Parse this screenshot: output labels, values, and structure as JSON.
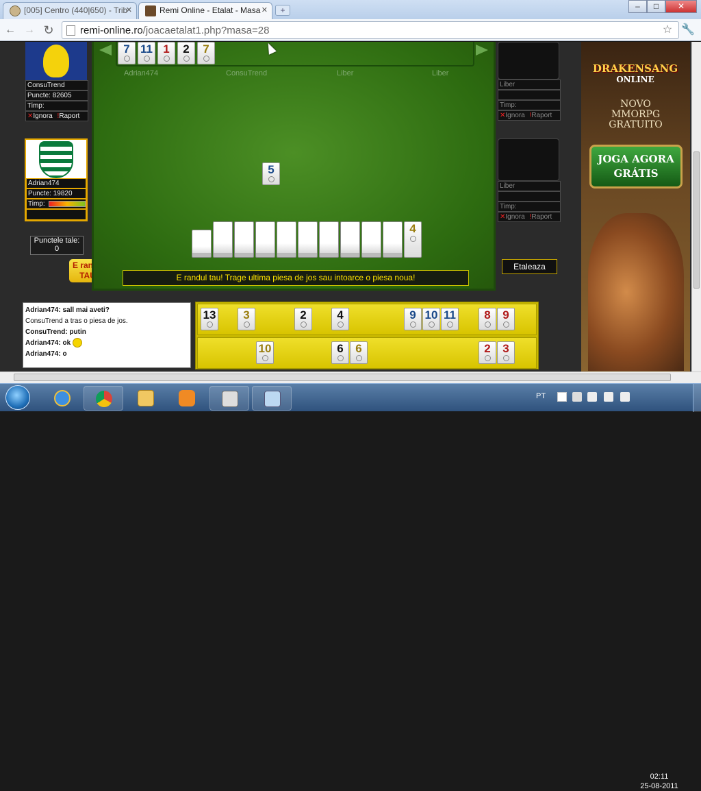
{
  "browser": {
    "tabs": [
      {
        "label": "[005] Centro (440|650) - Trib",
        "active": false
      },
      {
        "label": "Remi Online - Etalat - Masa",
        "active": true
      }
    ],
    "new_tab": "+",
    "url_host": "remi-online.ro",
    "url_path": "/joacaetalat1.php?masa=28",
    "window_buttons": [
      "–",
      "□",
      "✕"
    ]
  },
  "players_left": [
    {
      "name": "ConsuTrend",
      "puncte_label": "Puncte:",
      "puncte": "82605",
      "timp_label": "Timp:",
      "ignora": "Ignora",
      "raport": "Raport"
    },
    {
      "name": "Adrian474",
      "puncte_label": "Puncte:",
      "puncte": "19820",
      "timp_label": "Timp:"
    }
  ],
  "players_right": [
    {
      "name": "Liber",
      "timp_label": "Timp:",
      "ignora": "Ignora",
      "raport": "Raport"
    },
    {
      "name": "Liber",
      "timp_label": "Timp:",
      "ignora": "Ignora",
      "raport": "Raport"
    }
  ],
  "seat_names": [
    "Adrian474",
    "ConsuTrend",
    "Liber",
    "Liber"
  ],
  "discard_pile": [
    {
      "n": "7",
      "color": "blue"
    },
    {
      "n": "11",
      "color": "blue"
    },
    {
      "n": "1",
      "color": "red"
    },
    {
      "n": "2",
      "color": "black"
    },
    {
      "n": "7",
      "color": "yellow"
    }
  ],
  "center_tile": {
    "n": "5",
    "color": "blue"
  },
  "stock_last_tile": {
    "n": "4",
    "color": "yellow"
  },
  "punctele_tale": {
    "label": "Punctele tale:",
    "value": "0"
  },
  "randul_badge": {
    "line1": "E randul",
    "line2": "TAU!"
  },
  "message": "E randul tau! Trage ultima piesa de jos sau intoarce o piesa noua!",
  "etaleaza_button": "Etaleaza",
  "chat": [
    {
      "user": "Adrian474:",
      "text": "sall mai aveti?",
      "bold": true
    },
    {
      "user": "",
      "text": "ConsuTrend a tras o piesa de jos.",
      "bold": false
    },
    {
      "user": "ConsuTrend:",
      "text": "putin",
      "bold": true
    },
    {
      "user": "Adrian474:",
      "text": "ok",
      "bold": true,
      "smiley": true
    },
    {
      "user": "Adrian474:",
      "text": "o",
      "bold": true
    }
  ],
  "rack_row1": [
    {
      "n": "13",
      "color": "black"
    },
    {
      "n": "3",
      "color": "yellow"
    },
    {
      "n": "2",
      "color": "black"
    },
    {
      "n": "4",
      "color": "black"
    },
    {
      "n": "9",
      "color": "blue"
    },
    {
      "n": "10",
      "color": "blue"
    },
    {
      "n": "11",
      "color": "blue"
    },
    {
      "n": "8",
      "color": "red"
    },
    {
      "n": "9",
      "color": "red"
    }
  ],
  "rack_row2": [
    {
      "n": "10",
      "color": "yellow"
    },
    {
      "n": "6",
      "color": "black"
    },
    {
      "n": "6",
      "color": "yellow"
    },
    {
      "n": "2",
      "color": "red"
    },
    {
      "n": "3",
      "color": "red"
    }
  ],
  "ad": {
    "logo": "DRAKENSANG",
    "logo_sub": "ONLINE",
    "line1": "NOVO",
    "line2": "MMORPG",
    "line3": "GRATUITO",
    "cta1": "JOGA AGORA",
    "cta2": "GRÁTIS"
  },
  "taskbar": {
    "lang": "PT",
    "time": "02:11",
    "date": "25-08-2011"
  }
}
